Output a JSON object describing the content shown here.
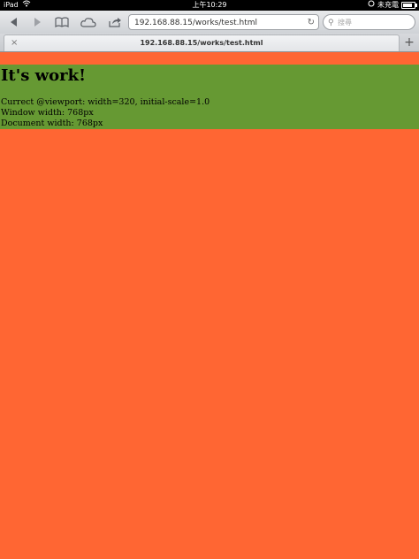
{
  "status_bar": {
    "device": "iPad",
    "time": "上午10:29",
    "battery_label": "未充電"
  },
  "toolbar": {
    "url": "192.168.88.15/works/test.html",
    "search_placeholder": "搜尋"
  },
  "tab": {
    "title": "192.168.88.15/works/test.html",
    "close": "×",
    "new_tab": "+"
  },
  "page": {
    "heading": "It's work!",
    "lines": [
      "Currect @viewport: width=320, initial-scale=1.0",
      "Window width: 768px",
      "Document width: 768px"
    ]
  },
  "colors": {
    "background": "#ff6633",
    "panel": "#669933"
  },
  "icons": {
    "back": "back-arrow-icon",
    "forward": "forward-arrow-icon",
    "bookmarks": "bookmarks-book-icon",
    "icloud": "cloud-icon",
    "share": "share-icon",
    "reload": "reload-icon",
    "search": "search-icon",
    "wifi": "wifi-icon",
    "lock": "rotation-lock-icon",
    "battery": "battery-icon"
  }
}
